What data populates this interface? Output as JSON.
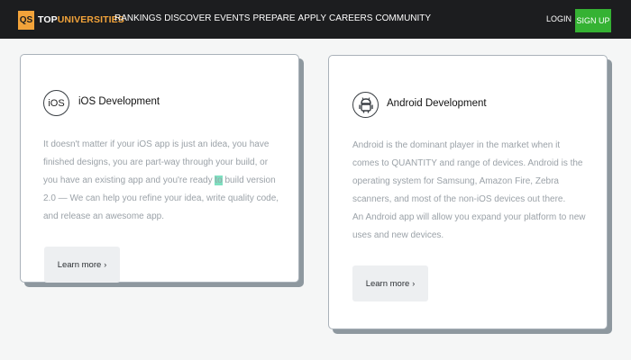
{
  "header": {
    "logo_badge": "QS",
    "logo_part1": "TOP",
    "logo_part2": "UNIVERSITIES",
    "nav": [
      "RANKINGS",
      "DISCOVER",
      "EVENTS",
      "PREPARE",
      "APPLY",
      "CAREERS",
      "COMMUNITY"
    ],
    "login": "LOGIN",
    "signup": "SIGN UP"
  },
  "cards": [
    {
      "title": "iOS Development",
      "icon": "ios-icon",
      "icon_text": "iOS",
      "body_before": "It doesn't matter if your iOS app is just an idea, you have finished designs, you are part-way through your build, or you have an existing app and you're ready ",
      "body_highlight": "to",
      "body_after": " build version 2.0 — We can help you refine your idea, write quality code, and release an awesome app.",
      "button": "Learn more",
      "button_icon": "chevron-right-icon"
    },
    {
      "title": "Android Development",
      "icon": "android-icon",
      "body_p1": "Android is the dominant player in the market when it comes to QUANTITY and range of devices. Android is the operating system for Samsung, Amazon Fire, Zebra scanners, and most of the non-iOS devices out there.",
      "body_p2": "An Android app will allow you expand your platform to new uses and new devices.",
      "button": "Learn more",
      "button_icon": "chevron-right-icon"
    }
  ],
  "colors": {
    "topbar": "#1c1d1f",
    "logo_accent": "#f2a33a",
    "signup": "#35b233",
    "highlight": "#7ee0c0"
  }
}
